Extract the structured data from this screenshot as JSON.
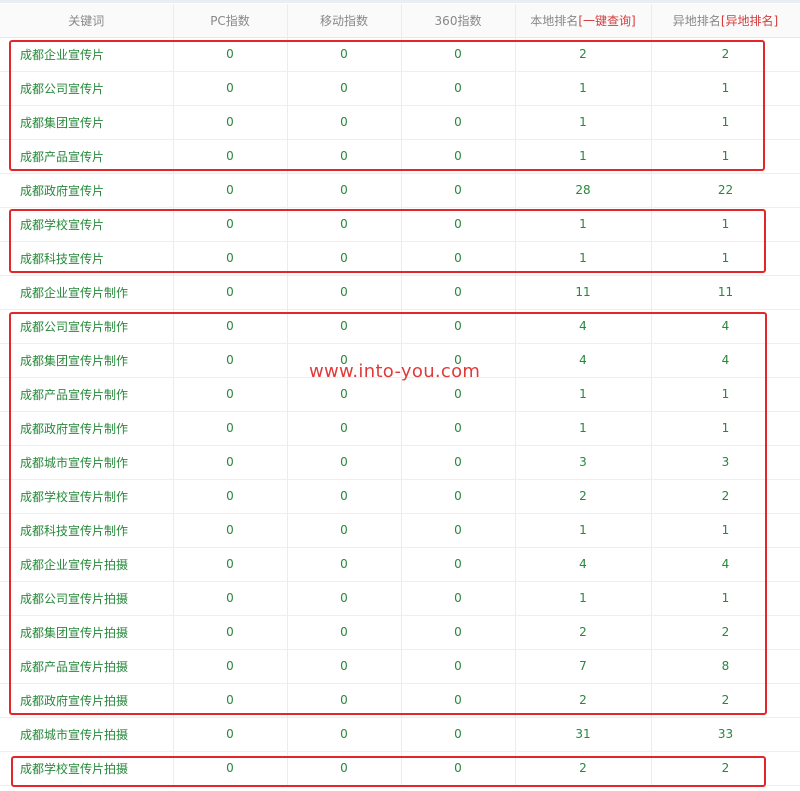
{
  "table": {
    "headers": {
      "keyword": "关键词",
      "pc_index": "PC指数",
      "mobile_index": "移动指数",
      "index_360": "360指数",
      "local_rank": "本地排名",
      "local_rank_link": "[一键查询]",
      "remote_rank": "异地排名",
      "remote_rank_link": "[异地排名]"
    },
    "rows": [
      {
        "keyword": "成都企业宣传片",
        "pc": "0",
        "mobile": "0",
        "i360": "0",
        "local": "2",
        "remote": "2"
      },
      {
        "keyword": "成都公司宣传片",
        "pc": "0",
        "mobile": "0",
        "i360": "0",
        "local": "1",
        "remote": "1"
      },
      {
        "keyword": "成都集团宣传片",
        "pc": "0",
        "mobile": "0",
        "i360": "0",
        "local": "1",
        "remote": "1"
      },
      {
        "keyword": "成都产品宣传片",
        "pc": "0",
        "mobile": "0",
        "i360": "0",
        "local": "1",
        "remote": "1"
      },
      {
        "keyword": "成都政府宣传片",
        "pc": "0",
        "mobile": "0",
        "i360": "0",
        "local": "28",
        "remote": "22"
      },
      {
        "keyword": "成都学校宣传片",
        "pc": "0",
        "mobile": "0",
        "i360": "0",
        "local": "1",
        "remote": "1"
      },
      {
        "keyword": "成都科技宣传片",
        "pc": "0",
        "mobile": "0",
        "i360": "0",
        "local": "1",
        "remote": "1"
      },
      {
        "keyword": "成都企业宣传片制作",
        "pc": "0",
        "mobile": "0",
        "i360": "0",
        "local": "11",
        "remote": "11"
      },
      {
        "keyword": "成都公司宣传片制作",
        "pc": "0",
        "mobile": "0",
        "i360": "0",
        "local": "4",
        "remote": "4"
      },
      {
        "keyword": "成都集团宣传片制作",
        "pc": "0",
        "mobile": "0",
        "i360": "0",
        "local": "4",
        "remote": "4"
      },
      {
        "keyword": "成都产品宣传片制作",
        "pc": "0",
        "mobile": "0",
        "i360": "0",
        "local": "1",
        "remote": "1"
      },
      {
        "keyword": "成都政府宣传片制作",
        "pc": "0",
        "mobile": "0",
        "i360": "0",
        "local": "1",
        "remote": "1"
      },
      {
        "keyword": "成都城市宣传片制作",
        "pc": "0",
        "mobile": "0",
        "i360": "0",
        "local": "3",
        "remote": "3"
      },
      {
        "keyword": "成都学校宣传片制作",
        "pc": "0",
        "mobile": "0",
        "i360": "0",
        "local": "2",
        "remote": "2"
      },
      {
        "keyword": "成都科技宣传片制作",
        "pc": "0",
        "mobile": "0",
        "i360": "0",
        "local": "1",
        "remote": "1"
      },
      {
        "keyword": "成都企业宣传片拍摄",
        "pc": "0",
        "mobile": "0",
        "i360": "0",
        "local": "4",
        "remote": "4"
      },
      {
        "keyword": "成都公司宣传片拍摄",
        "pc": "0",
        "mobile": "0",
        "i360": "0",
        "local": "1",
        "remote": "1"
      },
      {
        "keyword": "成都集团宣传片拍摄",
        "pc": "0",
        "mobile": "0",
        "i360": "0",
        "local": "2",
        "remote": "2"
      },
      {
        "keyword": "成都产品宣传片拍摄",
        "pc": "0",
        "mobile": "0",
        "i360": "0",
        "local": "7",
        "remote": "8"
      },
      {
        "keyword": "成都政府宣传片拍摄",
        "pc": "0",
        "mobile": "0",
        "i360": "0",
        "local": "2",
        "remote": "2"
      },
      {
        "keyword": "成都城市宣传片拍摄",
        "pc": "0",
        "mobile": "0",
        "i360": "0",
        "local": "31",
        "remote": "33"
      },
      {
        "keyword": "成都学校宣传片拍摄",
        "pc": "0",
        "mobile": "0",
        "i360": "0",
        "local": "2",
        "remote": "2"
      }
    ]
  },
  "watermark": "www.into-you.com",
  "colors": {
    "cell_text": "#27883b",
    "header_text": "#888888",
    "highlight_box": "#e2262a",
    "header_link": "#d63c3c"
  }
}
